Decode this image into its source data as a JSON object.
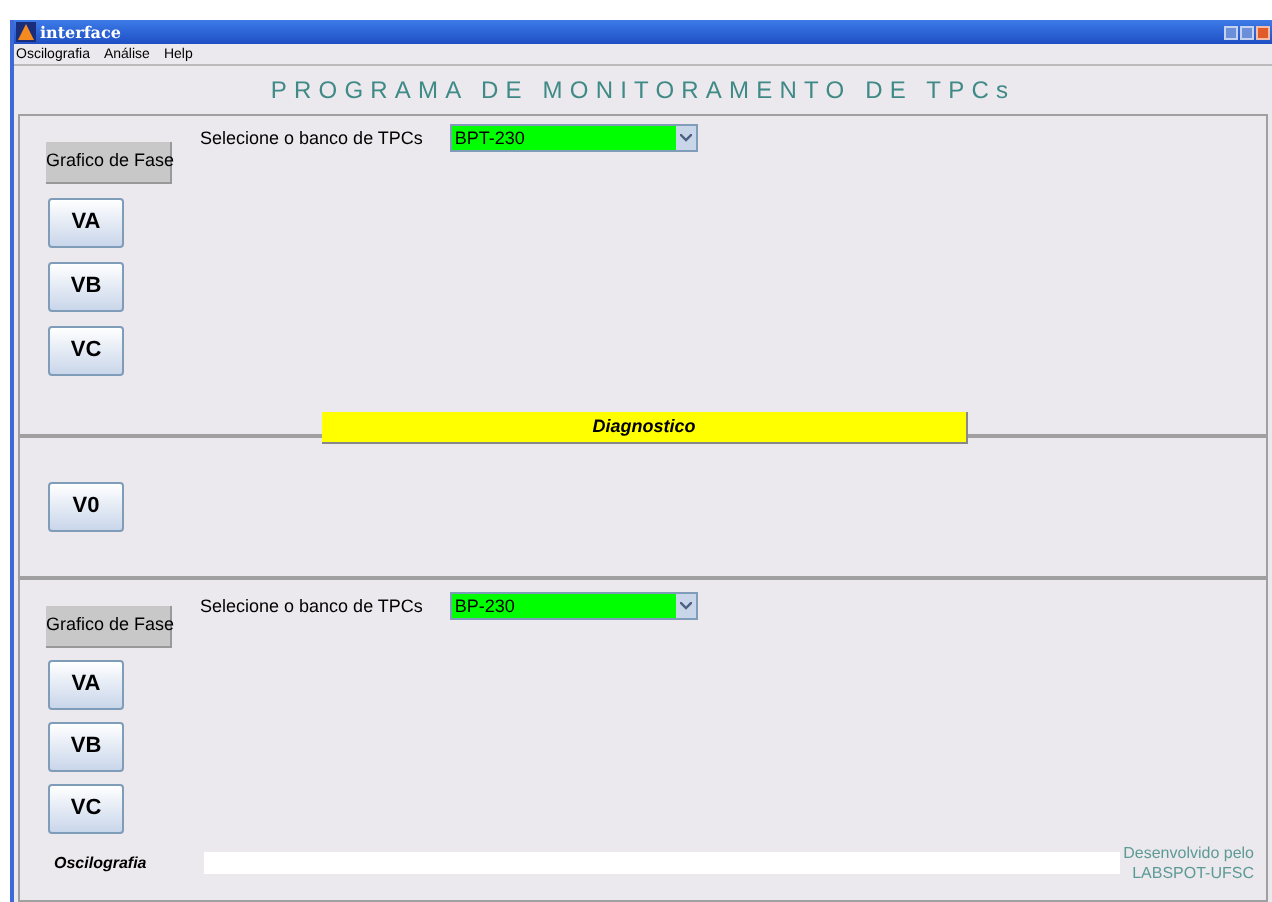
{
  "window": {
    "title": "interface"
  },
  "menu": [
    "Oscilografia",
    "Análise",
    "Help"
  ],
  "heading": "PROGRAMA DE MONITORAMENTO DE TPCs",
  "panel_top": {
    "phase_button": "Grafico de Fase",
    "select_label": "Selecione o banco de TPCs",
    "select_value": "BPT-230",
    "buttons": [
      "VA",
      "VB",
      "VC"
    ],
    "diagnostic_button": "Diagnostico"
  },
  "panel_middle": {
    "buttons": [
      "V0"
    ]
  },
  "panel_bottom": {
    "phase_button": "Grafico de Fase",
    "select_label": "Selecione o banco de TPCs",
    "select_value": "BP-230",
    "buttons": [
      "VA",
      "VB",
      "VC"
    ]
  },
  "footer": {
    "label": "Oscilografia",
    "credit_line_1": "Desenvolvido pelo",
    "credit_line_2": "LABSPOT-UFSC"
  }
}
